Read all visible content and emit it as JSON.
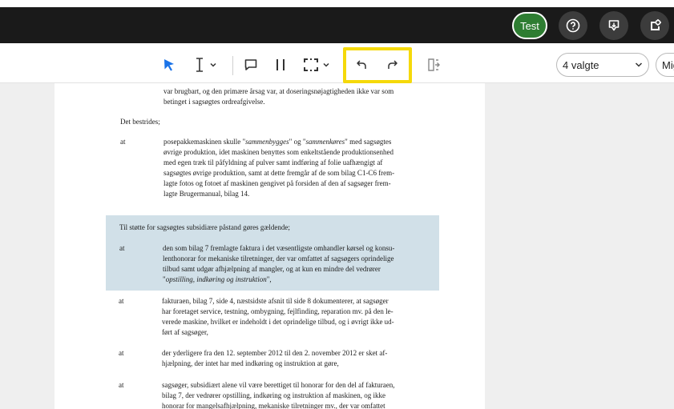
{
  "header": {
    "test_label": "Test"
  },
  "toolbar": {
    "select_value": "4 valgte",
    "partial_select_value": "Mig"
  },
  "icons": {
    "pointer": "arrow-pointer-icon",
    "text_cursor": "text-cursor-icon",
    "comment": "comment-icon",
    "pause": "columns-icon",
    "selection": "selection-frame-icon",
    "undo": "undo-icon",
    "redo": "redo-icon",
    "export": "export-icon",
    "help": "help-icon",
    "download": "download-icon",
    "settings": "settings-icon"
  },
  "colors": {
    "accent_blue": "#1a73e8",
    "test_green": "#2e7d32",
    "highlight_yellow": "#f5d90a",
    "paragraph_highlight": "#d1e0e8"
  },
  "document": {
    "intro_line1": "var brugbart, og den primære årsag var, at doseringsnøjagtigheden ikke var som",
    "intro_line2": "betinget i sagsøgtes ordreafgivelse.",
    "disputed": "Det bestrides;",
    "p1_marker": "at",
    "p1_l1a": "posepakkemaskinen skulle \"",
    "p1_l1b": "sammenbygges",
    "p1_l1c": "\" og \"",
    "p1_l1d": "sammenkøres",
    "p1_l1e": "\" med sagsøgtes",
    "p1_l2": "øvrige produktion, idet maskinen benyttes som enkeltstående produktionsenhed",
    "p1_l3": "med egen træk til påfyldning af pulver samt indføring af folie uafhængigt af",
    "p1_l4": "sagsøgtes øvrige produktion, samt at dette fremgår af de som bilag C1-C6 frem-",
    "p1_l5": "lagte fotos og fotoet af maskinen gengivet på forsiden af den af sagsøger frem-",
    "p1_l6": "lagte Brugermanual, bilag 14.",
    "support": "Til støtte for sagsøgtes subsidiære påstand gøres gældende;",
    "p2_marker": "at",
    "p2_l1": "den som bilag 7 fremlagte faktura i det væsentligste omhandler kørsel og konsu-",
    "p2_l2": "lenthonorar for mekaniske tilretninger, der var omfattet af sagsøgers oprindelige",
    "p2_l3": "tilbud samt udgør afhjælpning af mangler, og at kun en mindre del vedrører",
    "p2_l4a": "\"",
    "p2_l4b": "opstilling, indkøring og instruktion",
    "p2_l4c": "\",",
    "p3_marker": "at",
    "p3_l1": "fakturaen, bilag 7, side 4, næstsidste afsnit til side 8 dokumenterer, at sagsøger",
    "p3_l2": "har foretaget service, testning, ombygning, fejlfinding, reparation mv. på den le-",
    "p3_l3": "verede maskine, hvilket er indeholdt i det oprindelige tilbud, og i øvrigt ikke ud-",
    "p3_l4": "ført af sagsøger,",
    "p4_marker": "at",
    "p4_l1": "der yderligere fra den 12. september 2012 til den 2. november 2012 er sket af-",
    "p4_l2": "hjælpning, der intet har med indkøring og instruktion at gøre,",
    "p5_marker": "at",
    "p5_l1": "sagsøger, subsidiært alene vil være berettiget til honorar for den del af fakturaen,",
    "p5_l2": "bilag 7, der vedrører opstilling, indkøring og instruktion af maskinen, og ikke",
    "p5_l3": "honorar for mangelsafhjælpning, mekaniske tilretninger mv., der var omfattet"
  }
}
